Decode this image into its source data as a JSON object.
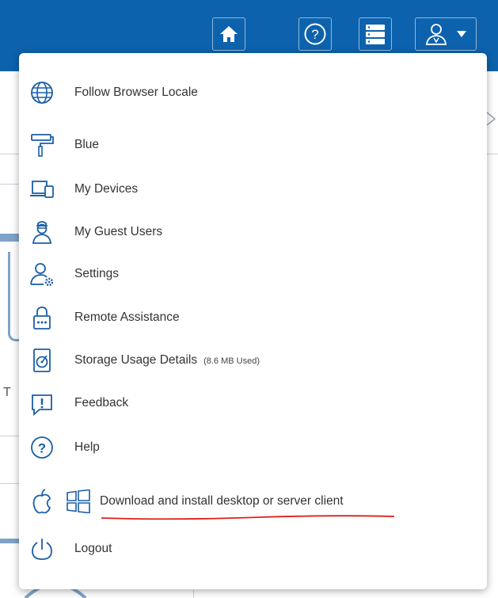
{
  "header": {
    "icons": [
      "home-icon",
      "help-icon",
      "servers-icon",
      "user-account-icon",
      "caret-down-icon"
    ]
  },
  "background": {
    "partial_text": "T"
  },
  "menu": {
    "items": [
      {
        "name": "menu-item-follow-browser-locale",
        "label": "Follow Browser Locale",
        "icon": "globe-icon"
      },
      {
        "name": "menu-item-theme-blue",
        "label": "Blue",
        "icon": "paint-roller-icon"
      },
      {
        "name": "menu-item-my-devices",
        "label": "My Devices",
        "icon": "devices-icon"
      },
      {
        "name": "menu-item-my-guest-users",
        "label": "My Guest Users",
        "icon": "guest-user-icon"
      },
      {
        "name": "menu-item-settings",
        "label": "Settings",
        "icon": "user-settings-icon"
      },
      {
        "name": "menu-item-remote-assistance",
        "label": "Remote Assistance",
        "icon": "lock-icon"
      },
      {
        "name": "menu-item-storage-usage",
        "label": "Storage Usage Details",
        "extra": "(8.6 MB Used)",
        "icon": "storage-disk-icon"
      },
      {
        "name": "menu-item-feedback",
        "label": "Feedback",
        "icon": "feedback-icon"
      },
      {
        "name": "menu-item-help",
        "label": "Help",
        "icon": "help-circle-icon"
      },
      {
        "name": "menu-item-download-client",
        "label": "Download and install desktop or server client",
        "icons": [
          "apple-icon",
          "windows-icon"
        ]
      },
      {
        "name": "menu-item-logout",
        "label": "Logout",
        "icon": "power-icon"
      }
    ]
  },
  "colors": {
    "header_bg": "#0d62ad",
    "icon_blue": "#1b5ea8",
    "annotation_red": "#e0201b"
  }
}
